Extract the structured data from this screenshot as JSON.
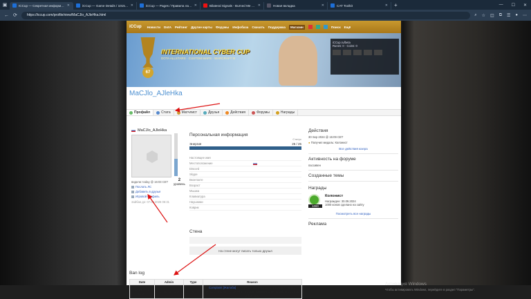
{
  "tabs": [
    {
      "title": "ICCup — Секретная информация",
      "active": true
    },
    {
      "title": "iCCup — Game Details / 1015707",
      "active": false
    },
    {
      "title": "iCCup — Pages / Правила ладдер",
      "active": false
    },
    {
      "title": "Bilateral Signals - Burned Me Dow",
      "active": false,
      "youtube": true
    },
    {
      "title": "Новая вкладка",
      "active": false
    },
    {
      "title": "CAT Toolkit",
      "active": false
    }
  ],
  "address": {
    "url": "https://iccup.com/profile/view/MaCJlo_AJleHka.html"
  },
  "site_nav": {
    "logo": "iCCup",
    "items": [
      "Новости",
      "DotA",
      "Рейтинг",
      "Другие карты",
      "Форумы",
      "Инфобаза",
      "Скачать",
      "Поддержка",
      "Магазин"
    ],
    "search": "Поиск",
    "more": "Ещё"
  },
  "banner": {
    "title": "INTERNATIONAL CYBER CUP",
    "subtitle": "DOTA ALLSTARS · CUSTOM MAPS · WARCRAFT III",
    "level": "67"
  },
  "user_panel": {
    "name": "iCCup.ru/beta",
    "runes": "Runes: 0",
    "coins": "Coins: 0"
  },
  "profile": {
    "title": "MaCJlo_AJleHka",
    "tabs": [
      "Профайл",
      "Стата",
      "Матчлист",
      "Друзья",
      "Действия",
      "Форумы",
      "Награды"
    ],
    "username": "MaCJlo_AJleHka",
    "level": "2",
    "level_label": "уровень",
    "seen": "видели: today @ 16:03 CET",
    "actions": [
      "Послать ЛС",
      "Добавить в друзья",
      "Игровой профиль"
    ],
    "registered": "Зайбан до: 07.09.2026 06:31"
  },
  "personal": {
    "heading": "Персональная информация",
    "status_label": "Статус",
    "energy_label": "Энергия",
    "energy_value": "25 / 25",
    "fields": [
      "Настоящее имя",
      "Местоположение",
      "Discord",
      "Skype",
      "Вконтакте",
      "Возраст",
      "Мышка",
      "Клавиатура",
      "Наушники",
      "Коврик"
    ]
  },
  "wall": {
    "heading": "Стена",
    "message": "На стене могут писать только друзья"
  },
  "actions": {
    "heading": "Действия",
    "date": "30 Sep 2024 @ 15:09 CET",
    "entry": "Получил медаль: Колонист",
    "all_link": "Все действия юзера"
  },
  "forum": {
    "heading": "Активность на форуме",
    "value": "пассивен"
  },
  "topics": {
    "heading": "Созданные темы"
  },
  "awards": {
    "heading": "Награды",
    "medal_name": "Колонист",
    "medal_date": "Награжден: 30.09.2024",
    "medal_desc": "1000 конов сделано на сайту",
    "medal_count": "1000",
    "all_link": "Посмотреть все награды"
  },
  "ads": {
    "heading": "Реклама"
  },
  "banlog": {
    "heading": "Ban log",
    "columns": [
      "Date",
      "Admin",
      "Type",
      "Reason"
    ],
    "rows": [
      {
        "date": "08.09.2026 06:31",
        "admin": "iCCup.Paradise",
        "type": "5",
        "reason_link": "Complaint [Жалоба]",
        "reason": "11. A deliberate death 2 or more times or one intentional death, followed by leaving from the game, in order to give an advantage"
      }
    ]
  },
  "watermark": {
    "line1": "Активация Windows",
    "line2": "Чтобы активировать Windows, перейдите в раздел \"Параметры\"."
  }
}
